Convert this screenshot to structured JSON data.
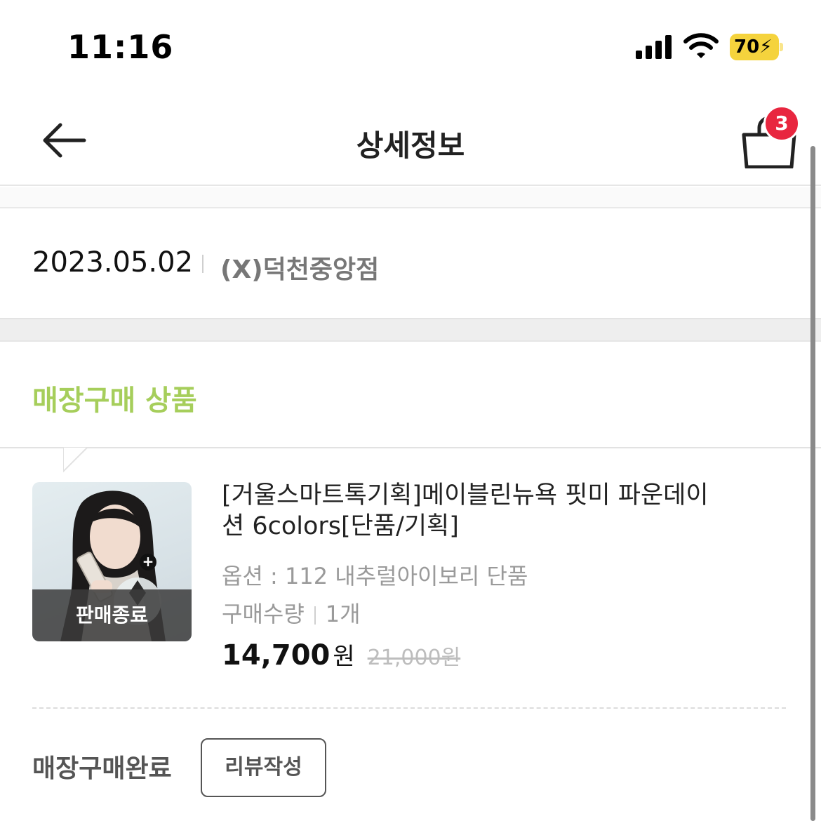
{
  "status_bar": {
    "time": "11:16",
    "battery_level": "70"
  },
  "header": {
    "title": "상세정보",
    "cart_count": "3"
  },
  "store": {
    "date": "2023.05.02",
    "name": "(X)덕천중앙점"
  },
  "section": {
    "title": "매장구매 상품"
  },
  "product": {
    "badge": "판매종료",
    "name": "[거울스마트톡기획]메이블린뉴욕 핏미 파운데이션 6colors[단품/기획]",
    "option": "옵션 : 112 내추럴아이보리 단품",
    "quantity_label": "구매수량",
    "quantity_value": "1개",
    "price": "14,700",
    "price_unit": "원",
    "original_price": "21,000원"
  },
  "footer": {
    "status": "매장구매완료",
    "review_button": "리뷰작성"
  },
  "colors": {
    "accent": "#a6ce5b",
    "badge": "#e8263f",
    "battery": "#f5d33d"
  }
}
